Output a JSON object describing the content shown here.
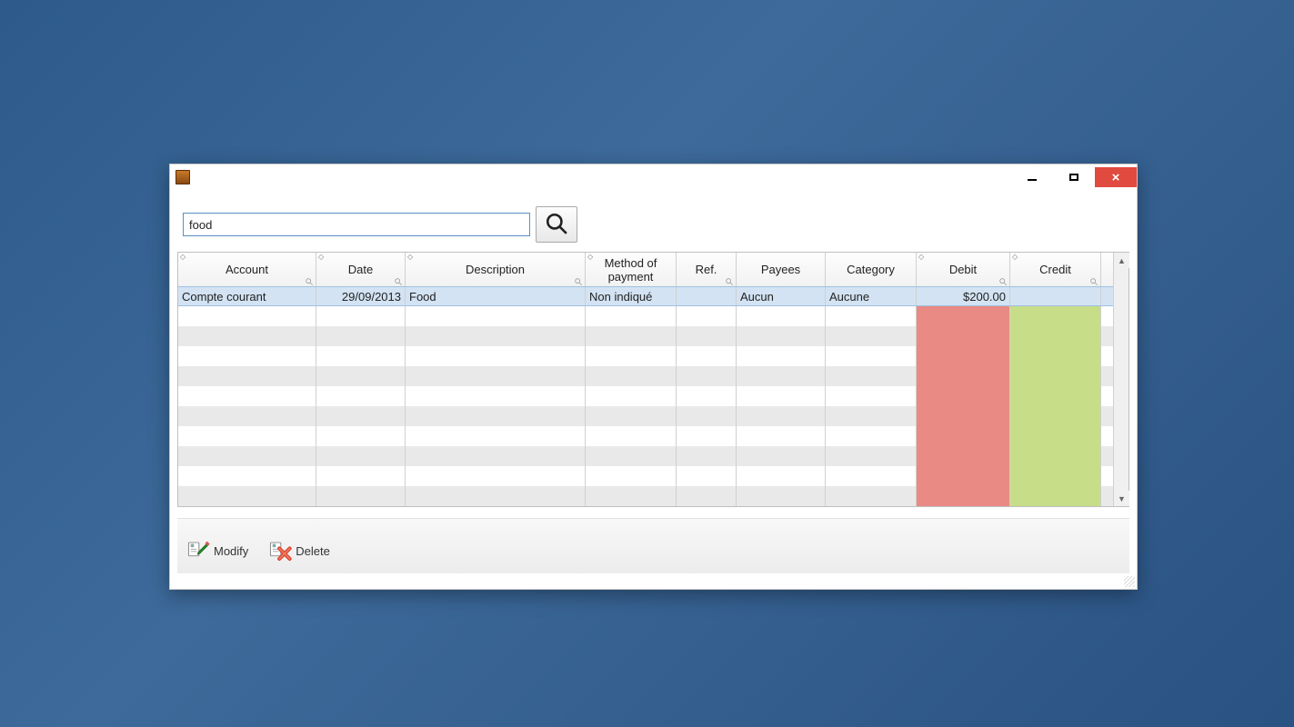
{
  "search": {
    "value": "food"
  },
  "columns": {
    "account": {
      "label": "Account",
      "sortable": true,
      "searchable": true
    },
    "date": {
      "label": "Date",
      "sortable": true,
      "searchable": true
    },
    "desc": {
      "label": "Description",
      "sortable": true,
      "searchable": true
    },
    "method": {
      "label": "Method of payment",
      "sortable": true,
      "searchable": false
    },
    "ref": {
      "label": "Ref.",
      "sortable": false,
      "searchable": true
    },
    "payees": {
      "label": "Payees",
      "sortable": false,
      "searchable": false
    },
    "category": {
      "label": "Category",
      "sortable": false,
      "searchable": false
    },
    "debit": {
      "label": "Debit",
      "sortable": true,
      "searchable": true
    },
    "credit": {
      "label": "Credit",
      "sortable": true,
      "searchable": true
    }
  },
  "rows": [
    {
      "account": "Compte courant",
      "date": "29/09/2013",
      "desc": "Food",
      "method": "Non indiqué",
      "ref": "",
      "payees": "Aucun",
      "category": "Aucune",
      "debit": "$200.00",
      "credit": ""
    }
  ],
  "empty_row_count": 10,
  "toolbar": {
    "modify_label": "Modify",
    "delete_label": "Delete"
  },
  "colors": {
    "debit_bg": "#e98a84",
    "credit_bg": "#c8dd87",
    "selection": "#d3e3f3"
  }
}
